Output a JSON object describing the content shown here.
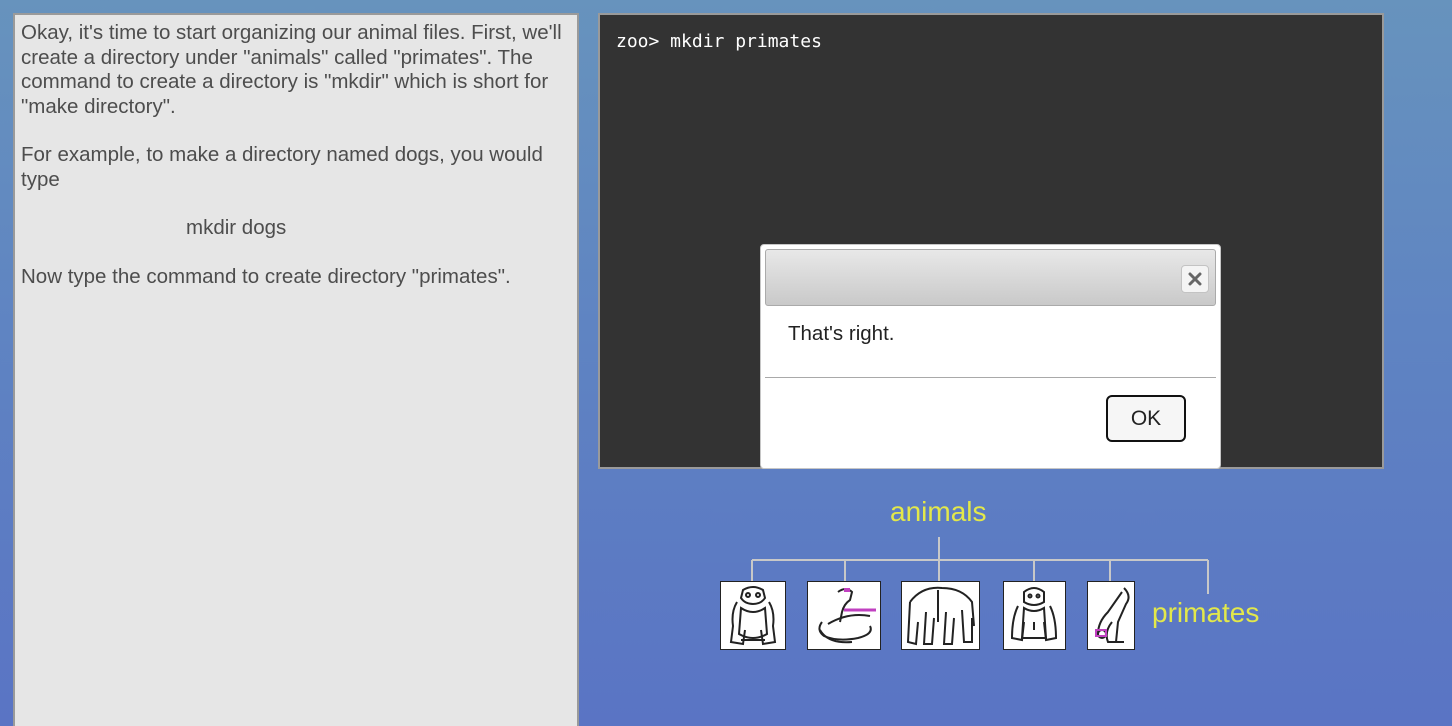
{
  "instructions": {
    "paragraph1": "Okay, it's time to start organizing our animal files. First, we'll create a directory under \"animals\" called \"primates\". The command to create a directory is \"mkdir\" which is short for \"make directory\".",
    "paragraph2": "For example, to make a directory named dogs, you would type",
    "example_command": "mkdir dogs",
    "paragraph3": "Now type the command to create directory \"primates\"."
  },
  "terminal": {
    "line": "zoo> mkdir primates"
  },
  "dialog": {
    "message": "That's right.",
    "ok_label": "OK",
    "close_icon": "close-x-icon"
  },
  "tree": {
    "root_label": "animals",
    "new_dir_label": "primates",
    "icons": [
      "monkey-icon",
      "snake-icon",
      "elephant-icon",
      "gorilla-icon",
      "small-monkey-icon"
    ]
  },
  "colors": {
    "background": "#5f84c2",
    "terminal_bg": "#333333",
    "panel_bg": "#e6e6e6",
    "tree_label": "#e3e84a"
  }
}
